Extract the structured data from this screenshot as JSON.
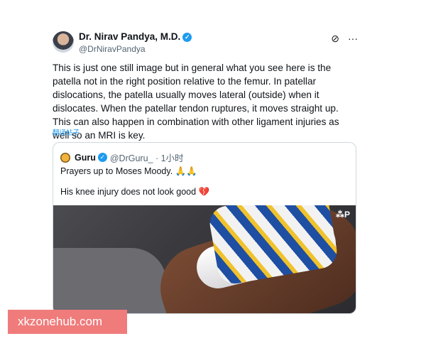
{
  "author": {
    "name": "Dr. Nirav Pandya, M.D.",
    "handle": "@DrNiravPandya",
    "verified_icon": "✓"
  },
  "icons": {
    "grok": "⊘",
    "more": "···"
  },
  "tweet_text": "This is just one still image but in general what you see here is the patella not in the right position relative to the femur. In patellar dislocations, the patella usually moves lateral (outside) when it dislocates.  When the patellar tendon ruptures, it moves straight up.  This can also happen in combination with other ligament injuries as well so an MRI is key.",
  "translate_label": "翻译帖子",
  "quote": {
    "name": "Guru",
    "handle": "@DrGuru_ · 1小时",
    "line1": "Prayers up to Moses Moody. 🙏🙏",
    "line2": "His knee injury does not look good 💔",
    "media_badge": "⁂P"
  },
  "watermark": "xkzonehub.com"
}
